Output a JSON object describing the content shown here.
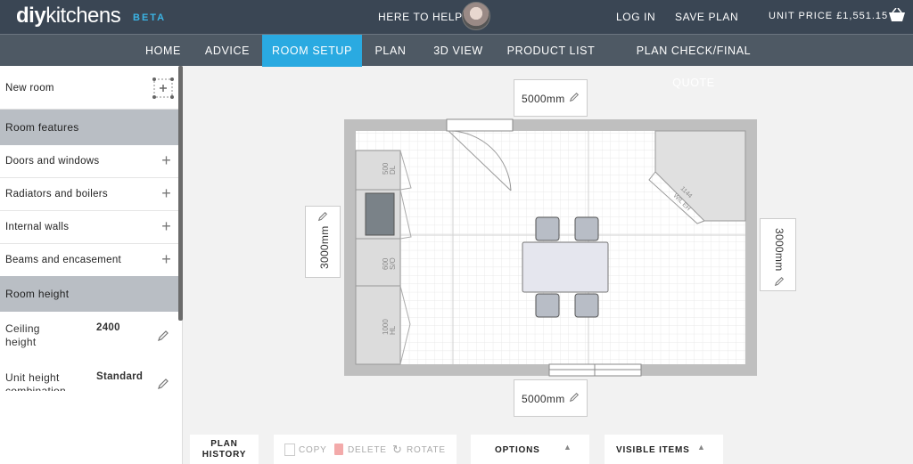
{
  "header": {
    "logo_bold": "diy",
    "logo_rest": "kitchens",
    "beta": "BETA",
    "help": "HERE TO HELP",
    "login": "LOG IN",
    "save_plan": "SAVE PLAN",
    "unit_price": "UNIT PRICE £1,551.15"
  },
  "nav": [
    "HOME",
    "ADVICE",
    "ROOM SETUP",
    "PLAN",
    "3D VIEW",
    "PRODUCT LIST",
    "PLAN CHECK/FINAL QUOTE"
  ],
  "sidebar": {
    "new_room": "New room",
    "room_features": "Room features",
    "items": [
      "Doors and windows",
      "Radiators and boilers",
      "Internal walls",
      "Beams and encasement"
    ],
    "room_height": "Room height",
    "ceiling_label_1": "Ceiling",
    "ceiling_label_2": "height",
    "ceiling_value": "2400",
    "unit_label_1": "Unit height",
    "unit_label_2": "combination",
    "unit_value": "Standard"
  },
  "dims": {
    "top": "5000mm",
    "bottom": "5000mm",
    "left": "3000mm",
    "right": "3000mm"
  },
  "units": {
    "u1": "500",
    "u1b": "DL",
    "u2": "600",
    "u2b": "S/O",
    "u3": "1000",
    "u3b": "HL",
    "corner_1": "1144",
    "corner_2": "WIL EH"
  },
  "bottom": {
    "plan_history_1": "PLAN",
    "plan_history_2": "HISTORY",
    "copy": "COPY",
    "delete": "DELETE",
    "rotate": "ROTATE",
    "options": "OPTIONS",
    "visible_items": "VISIBLE ITEMS"
  },
  "colors": {
    "accent": "#2aaae1",
    "topbar": "#3a4654",
    "nav": "#4e5964",
    "section": "#b9bec4"
  }
}
